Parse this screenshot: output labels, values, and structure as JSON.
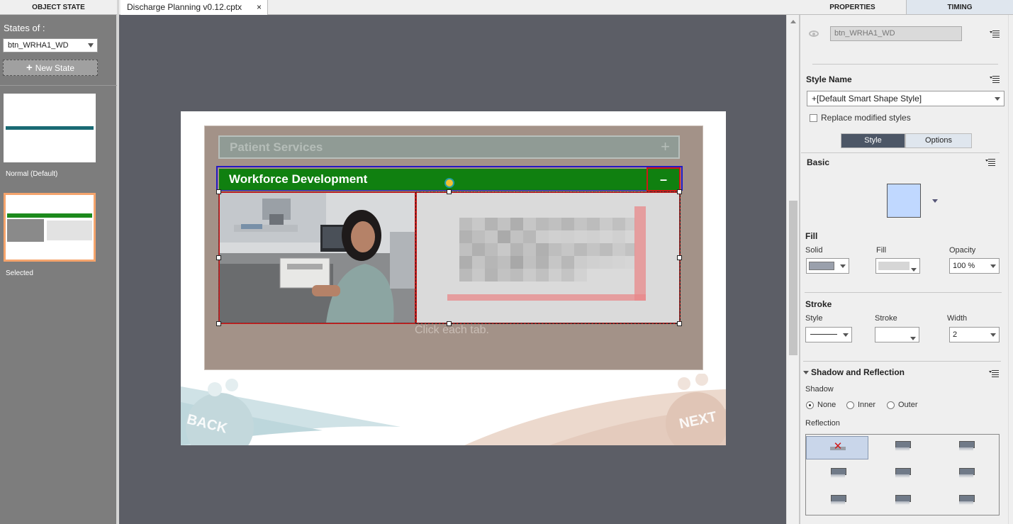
{
  "left_panel": {
    "tab_label": "OBJECT STATE",
    "states_of_label": "States of :",
    "states_select_value": "btn_WRHA1_WD",
    "new_state_label": "New State",
    "states": [
      {
        "label": "Normal (Default)",
        "selected": false
      },
      {
        "label": "Selected",
        "selected": true
      }
    ]
  },
  "document": {
    "tab_title": "Discharge Planning v0.12.cptx",
    "close_glyph": "×"
  },
  "slide": {
    "tab_patient_services": "Patient Services",
    "tab_workforce_development": "Workforce Development",
    "plus_glyph": "+",
    "minus_glyph": "–",
    "click_each_tab": "Click each tab.",
    "back_label": "BACK",
    "next_label": "NEXT"
  },
  "right_panel": {
    "tab_properties": "PROPERTIES",
    "tab_timing": "TIMING",
    "object_name": "btn_WRHA1_WD",
    "style_name_label": "Style Name",
    "style_name_value": "+[Default Smart Shape Style]",
    "replace_modified_styles": "Replace modified styles",
    "seg_style": "Style",
    "seg_options": "Options",
    "basic_label": "Basic",
    "fill_section": "Fill",
    "fill_solid_label": "Solid",
    "fill_fill_label": "Fill",
    "opacity_label": "Opacity",
    "opacity_value": "100 %",
    "stroke_section": "Stroke",
    "stroke_style_label": "Style",
    "stroke_stroke_label": "Stroke",
    "stroke_width_label": "Width",
    "stroke_width_value": "2",
    "shadow_reflection_label": "Shadow and Reflection",
    "shadow_label": "Shadow",
    "shadow_none": "None",
    "shadow_inner": "Inner",
    "shadow_outer": "Outer",
    "shadow_selected": "None",
    "reflection_label": "Reflection"
  },
  "colors": {
    "accent_green": "#108010",
    "selection_red": "#d01818",
    "selected_state_border": "#f5a46c",
    "swatch_fill": "#c0d8ff"
  },
  "icons": [
    "plus-icon",
    "dropdown-arrow-icon",
    "close-icon",
    "eye-icon",
    "panel-menu-icon",
    "pivot-icon",
    "reflection-none-icon",
    "reflection-option-icon"
  ]
}
